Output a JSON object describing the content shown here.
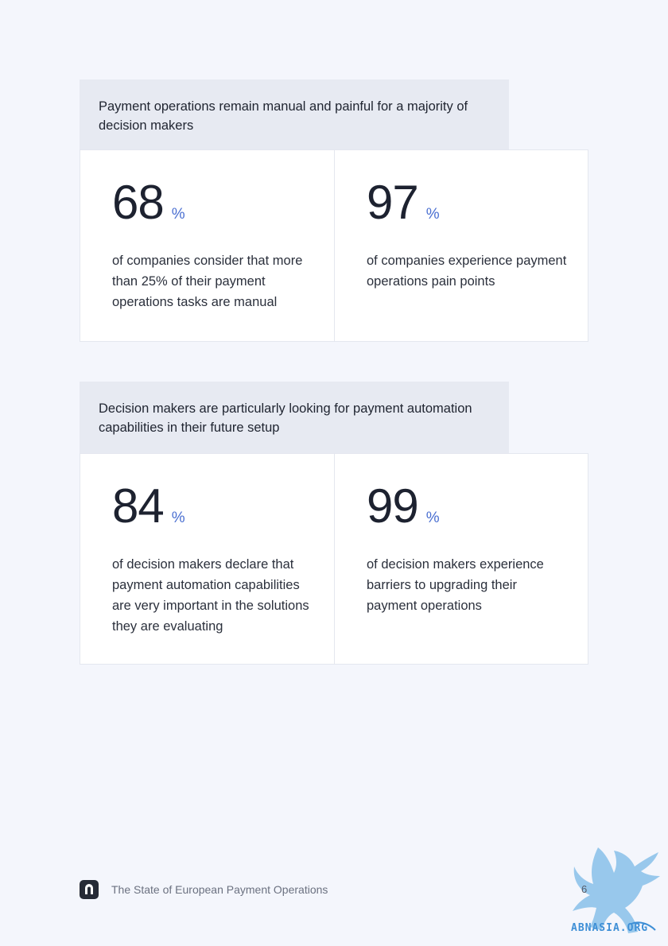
{
  "sections": [
    {
      "heading": "Payment operations remain manual and painful for a majority of decision makers",
      "stats": [
        {
          "number": "68",
          "unit": "%",
          "description": "of companies consider that more than 25% of their payment operations tasks are manual"
        },
        {
          "number": "97",
          "unit": "%",
          "description": "of companies experience payment operations pain points"
        }
      ]
    },
    {
      "heading": "Decision makers are particularly looking for payment automation capabilities in their future setup",
      "stats": [
        {
          "number": "84",
          "unit": "%",
          "description": "of decision makers declare that payment automation capabilities are very important in the solutions they are evaluating"
        },
        {
          "number": "99",
          "unit": "%",
          "description": "of decision makers experience barriers to upgrading their payment operations"
        }
      ]
    }
  ],
  "footer": {
    "title": "The State of European Payment Operations",
    "page_number": "6"
  },
  "watermark": {
    "text": "ABNASIA.ORG"
  },
  "colors": {
    "accent": "#4a6fd1",
    "background": "#f4f6fc",
    "heading_bg": "#e7eaf2"
  }
}
